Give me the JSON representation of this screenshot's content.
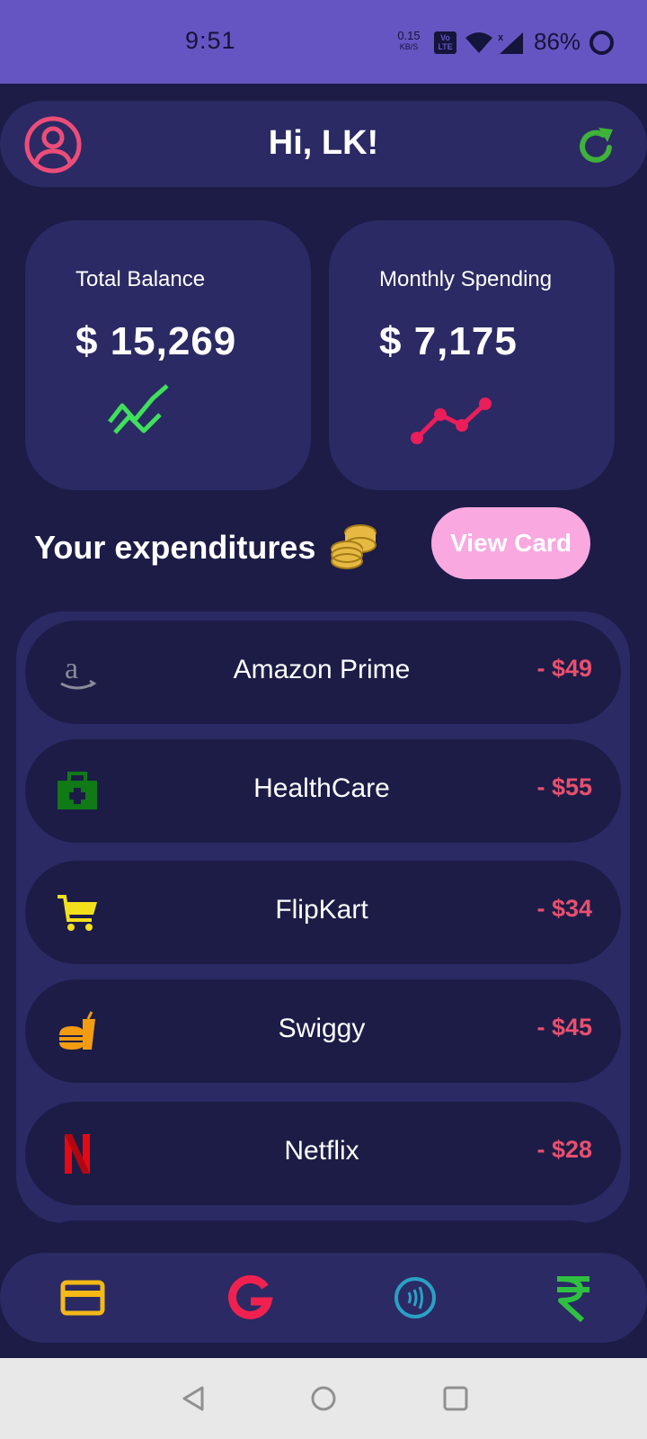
{
  "status_bar": {
    "time": "9:51",
    "net_speed": "0.15",
    "net_unit": "KB/S",
    "volte_label": "Vo LTE",
    "battery": "86%"
  },
  "header": {
    "greeting": "Hi, LK!",
    "avatar_icon": "user-circle-icon",
    "refresh_icon": "refresh-icon"
  },
  "cards": {
    "total_balance": {
      "label": "Total Balance",
      "amount": "$ 15,269",
      "trend_icon": "trending-up-icon",
      "color": "#3fe05a"
    },
    "monthly_spending": {
      "label": "Monthly Spending",
      "amount": "$ 7,175",
      "trend_icon": "line-chart-icon",
      "color": "#e91e5a"
    }
  },
  "expenditures": {
    "title": "Your expenditures",
    "view_card_label": "View Card",
    "items": [
      {
        "name": "Amazon Prime",
        "amount": "- $49",
        "icon": "amazon-icon"
      },
      {
        "name": "HealthCare",
        "amount": "- $55",
        "icon": "medical-kit-icon"
      },
      {
        "name": "FlipKart",
        "amount": "- $34",
        "icon": "shopping-cart-icon"
      },
      {
        "name": "Swiggy",
        "amount": "- $45",
        "icon": "food-icon"
      },
      {
        "name": "Netflix",
        "amount": "- $28",
        "icon": "netflix-icon"
      }
    ]
  },
  "bottom_nav": {
    "items": [
      "credit-card-icon",
      "google-icon",
      "contactless-icon",
      "rupee-icon"
    ]
  },
  "colors": {
    "background": "#1c1c47",
    "panel": "#2b2a64",
    "status_bar": "#6555c2",
    "amount_red": "#e8506e",
    "button_pink": "#f9a8e0"
  }
}
